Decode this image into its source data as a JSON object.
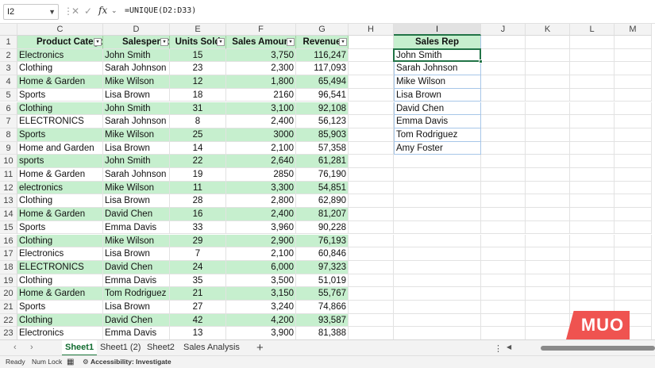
{
  "formula_bar": {
    "name_box": "I2",
    "fx": "fx",
    "formula": "=UNIQUE(D2:D33)"
  },
  "columns": [
    "C",
    "D",
    "E",
    "F",
    "G",
    "H",
    "I",
    "J",
    "K",
    "L",
    "M"
  ],
  "rows": [
    "1",
    "2",
    "3",
    "4",
    "5",
    "6",
    "7",
    "8",
    "9",
    "10",
    "11",
    "12",
    "13",
    "14",
    "15",
    "16",
    "17",
    "18",
    "19",
    "20",
    "21",
    "22",
    "23"
  ],
  "table": {
    "headers": [
      "Product Categor",
      "Salespersor",
      "Units Sold",
      "Sales Amoun",
      "Revenue"
    ],
    "data": [
      [
        "Electronics",
        "John Smith",
        "15",
        "3,750",
        "116,247"
      ],
      [
        "Clothing",
        "Sarah Johnson",
        "23",
        "2,300",
        "117,093"
      ],
      [
        "Home & Garden",
        "Mike Wilson",
        "12",
        "1,800",
        "65,494"
      ],
      [
        "Sports",
        "Lisa Brown",
        "18",
        "2160",
        "96,541"
      ],
      [
        "Clothing",
        "John Smith",
        "31",
        "3,100",
        "92,108"
      ],
      [
        "ELECTRONICS",
        "Sarah Johnson",
        "8",
        "2,400",
        "56,123"
      ],
      [
        "Sports",
        "Mike Wilson",
        "25",
        "3000",
        "85,903"
      ],
      [
        "Home and Garden",
        "Lisa Brown",
        "14",
        "2,100",
        "57,358"
      ],
      [
        "sports",
        "John Smith",
        "22",
        "2,640",
        "61,281"
      ],
      [
        "Home & Garden",
        "Sarah Johnson",
        "19",
        "2850",
        "76,190"
      ],
      [
        "electronics",
        "Mike Wilson",
        "11",
        "3,300",
        "54,851"
      ],
      [
        "Clothing",
        "Lisa Brown",
        "28",
        "2,800",
        "62,890"
      ],
      [
        "Home & Garden",
        "David Chen",
        "16",
        "2,400",
        "81,207"
      ],
      [
        "Sports",
        "Emma Davis",
        "33",
        "3,960",
        "90,228"
      ],
      [
        "Clothing",
        "Mike Wilson",
        "29",
        "2,900",
        "76,193"
      ],
      [
        "Electronics",
        "Lisa Brown",
        "7",
        "2,100",
        "60,846"
      ],
      [
        "ELECTRONICS",
        "David Chen",
        "24",
        "6,000",
        "97,323"
      ],
      [
        "Clothing",
        "Emma Davis",
        "35",
        "3,500",
        "51,019"
      ],
      [
        "Home & Garden",
        "Tom Rodriguez",
        "21",
        "3,150",
        "55,767"
      ],
      [
        "Sports",
        "Lisa Brown",
        "27",
        "3,240",
        "74,866"
      ],
      [
        "Clothing",
        "David Chen",
        "42",
        "4,200",
        "93,587"
      ],
      [
        "Electronics",
        "Emma Davis",
        "13",
        "3,900",
        "81,388"
      ]
    ]
  },
  "unique": {
    "header": "Sales Rep",
    "values": [
      "John Smith",
      "Sarah Johnson",
      "Mike Wilson",
      "Lisa Brown",
      "David Chen",
      "Emma Davis",
      "Tom Rodriguez",
      "Amy Foster"
    ]
  },
  "sheet_tabs": [
    "Sheet1",
    "Sheet1 (2)",
    "Sheet2",
    "Sales Analysis"
  ],
  "active_tab": "Sheet1",
  "add_sheet": "+",
  "status": {
    "ready": "Ready",
    "num_lock": "Num Lock",
    "accessibility": "Accessibility: Investigate"
  },
  "logo_text": "MUO",
  "colors": {
    "table_green": "#c6efce",
    "selection_green": "#217346",
    "logo_red": "#ef5350"
  }
}
